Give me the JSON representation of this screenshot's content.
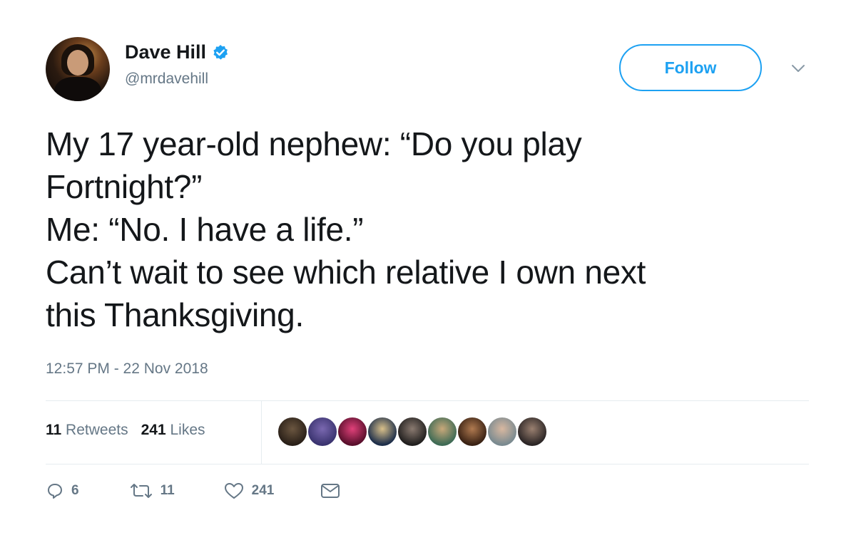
{
  "user": {
    "display_name": "Dave Hill",
    "handle": "@mrdavehill",
    "verified": true
  },
  "follow_label": "Follow",
  "tweet": {
    "lines": [
      "My 17 year-old nephew: “Do you play",
      "Fortnight?”",
      "Me: “No. I have a life.”",
      "Can’t wait to see which relative I own next",
      "this Thanksgiving."
    ]
  },
  "timestamp": "12:57 PM - 22 Nov 2018",
  "stats": {
    "retweets_count": "11",
    "retweets_label": "Retweets",
    "likes_count": "241",
    "likes_label": "Likes"
  },
  "actions": {
    "reply_count": "6",
    "retweet_count": "11",
    "like_count": "241"
  },
  "icons": {
    "verified": "verified-badge-icon",
    "caret": "chevron-down-icon",
    "reply": "reply-icon",
    "retweet": "retweet-icon",
    "like": "heart-icon",
    "message": "envelope-icon"
  },
  "colors": {
    "accent": "#1da1f2",
    "secondary_text": "#657786",
    "divider": "#e6ecf0"
  }
}
